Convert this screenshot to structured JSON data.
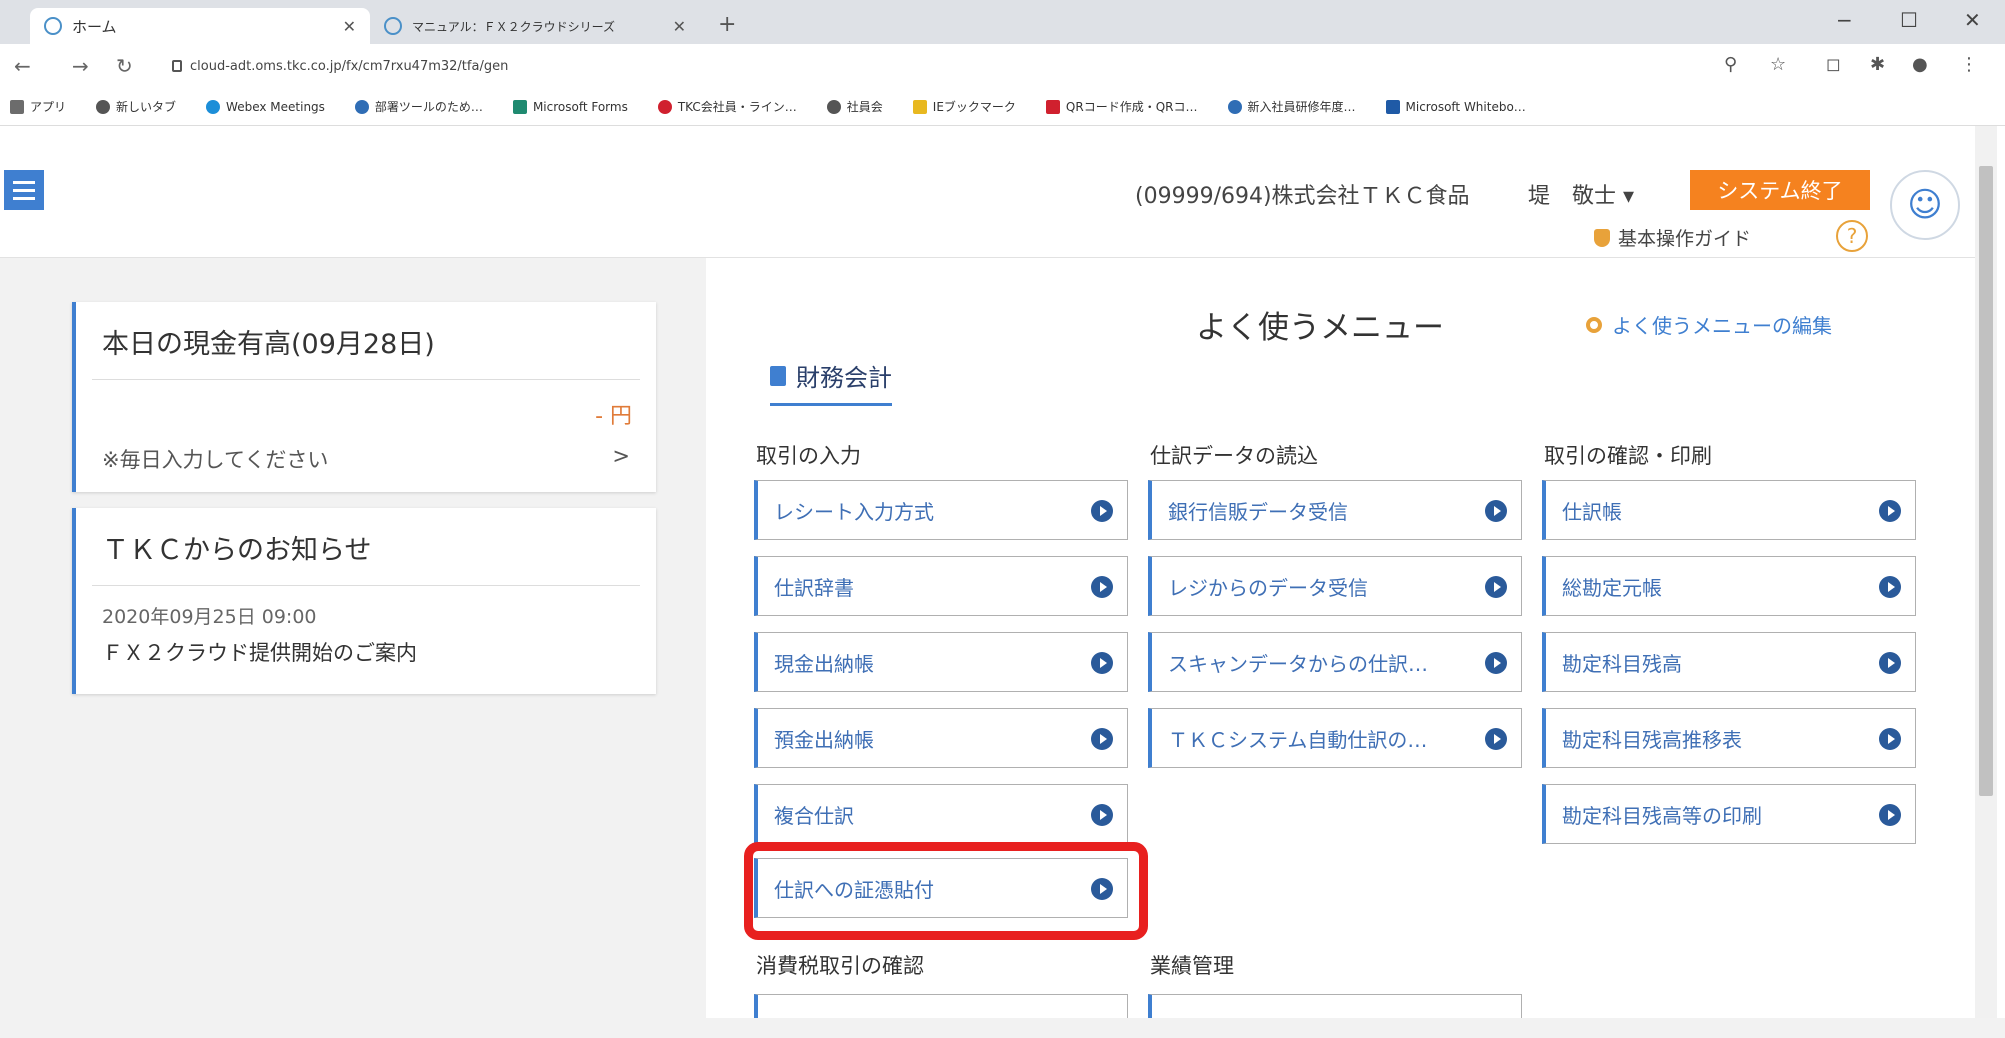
{
  "browser": {
    "tabs": [
      {
        "label": "ホーム",
        "active": true
      },
      {
        "label": "マニュアル：ＦＸ２クラウドシリーズ",
        "active": false
      }
    ],
    "new_tab": "+",
    "window_controls": [
      "−",
      "☐",
      "✕"
    ],
    "url": "cloud-adt.oms.tkc.co.jp/fx/cm7rxu47m32/tfa/gen",
    "bookmarks": [
      {
        "label": "アプリ",
        "color": "#6c6c6c"
      },
      {
        "label": "新しいタブ",
        "color": "#555555"
      },
      {
        "label": "Webex Meetings",
        "color": "#1c8ed8"
      },
      {
        "label": "部署ツールのため…",
        "color": "#2f6db5"
      },
      {
        "label": "Microsoft Forms",
        "color": "#1f8a70"
      },
      {
        "label": "TKC会社員・ライン…",
        "color": "#d0202e"
      },
      {
        "label": "社員会",
        "color": "#555555"
      },
      {
        "label": "IEブックマーク",
        "color": "#e8b820"
      },
      {
        "label": "QRコード作成・QRコ…",
        "color": "#d0202e"
      },
      {
        "label": "新入社員研修年度…",
        "color": "#2f6db5"
      },
      {
        "label": "Microsoft Whitebo…",
        "color": "#1f5aa6"
      }
    ]
  },
  "header": {
    "company": "(09999/694)株式会社ＴＫＣ食品",
    "user": "堤　敬士 ▾",
    "system_end": "システム終了",
    "guide": "基本操作ガイド",
    "help": "?"
  },
  "left": {
    "cash": {
      "title": "本日の現金有高(09月28日)",
      "amount": "- 円",
      "note": "※毎日入力してください",
      "chevron": ">"
    },
    "news": {
      "title": "ＴＫＣからのお知らせ",
      "date": "2020年09月25日 09:00",
      "text": "ＦＸ２クラウド提供開始のご案内"
    }
  },
  "menu": {
    "title": "よく使うメニュー",
    "edit": "よく使うメニューの編集",
    "section": "財務会計",
    "columns": [
      {
        "heading": "取引の入力",
        "items": [
          "レシート入力方式",
          "仕訳辞書",
          "現金出納帳",
          "預金出納帳",
          "複合仕訳",
          "仕訳への証憑貼付"
        ]
      },
      {
        "heading": "仕訳データの読込",
        "items": [
          "銀行信販データ受信",
          "レジからのデータ受信",
          "スキャンデータからの仕訳…",
          "ＴＫＣシステム自動仕訳の…"
        ]
      },
      {
        "heading": "取引の確認・印刷",
        "items": [
          "仕訳帳",
          "総勘定元帳",
          "勘定科目残高",
          "勘定科目残高推移表",
          "勘定科目残高等の印刷"
        ]
      }
    ],
    "bottom_headings": [
      "消費税取引の確認",
      "業績管理"
    ],
    "highlight_color": "#e8201f"
  }
}
